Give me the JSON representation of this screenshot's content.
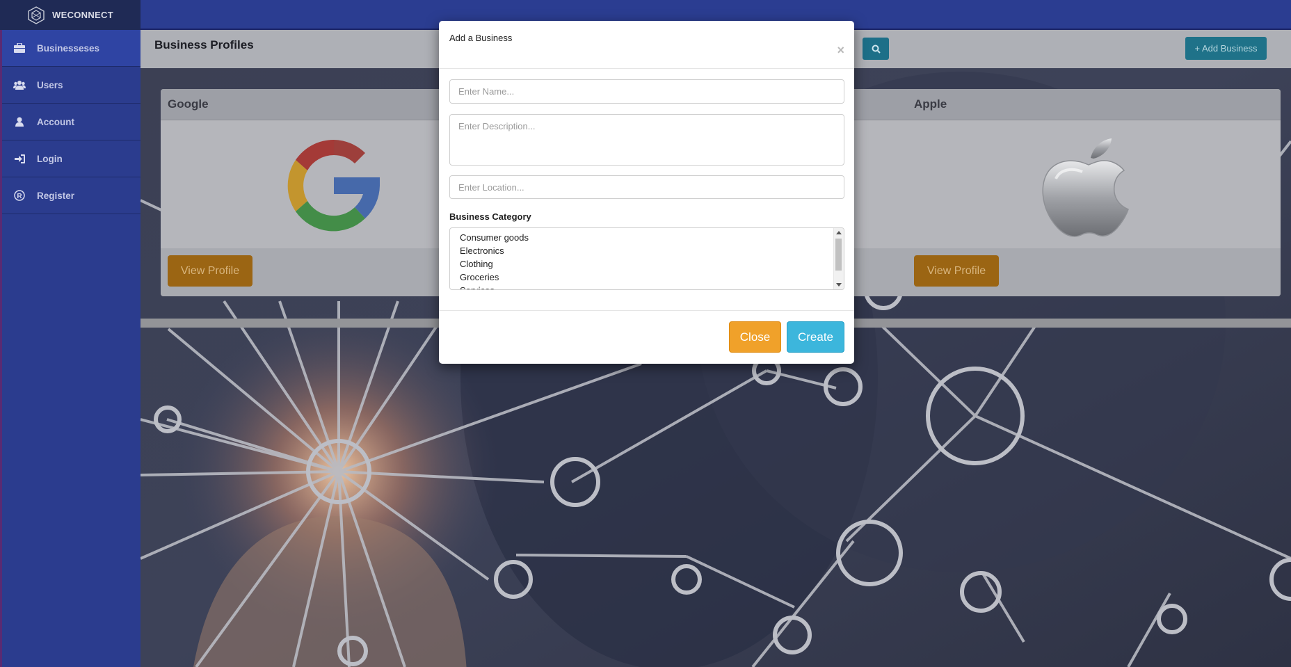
{
  "brand": {
    "name": "WECONNECT",
    "icon": "hexagon-logo-icon"
  },
  "sidebar": {
    "items": [
      {
        "label": "Businesseses",
        "icon": "briefcase-icon",
        "active": true
      },
      {
        "label": "Users",
        "icon": "users-icon",
        "active": false
      },
      {
        "label": "Account",
        "icon": "user-icon",
        "active": false
      },
      {
        "label": "Login",
        "icon": "sign-in-icon",
        "active": false
      },
      {
        "label": "Register",
        "icon": "registered-icon",
        "active": false
      }
    ]
  },
  "header": {
    "title": "Business Profiles",
    "search_icon": "search-icon",
    "add_label": "+ Add Business"
  },
  "cards": [
    {
      "name": "Google",
      "logo": "google-logo",
      "button": "View Profile"
    },
    {
      "name": "Apple",
      "logo": "apple-logo",
      "button": "View Profile"
    }
  ],
  "modal": {
    "title": "Add a Business",
    "close_symbol": "×",
    "name_placeholder": "Enter Name...",
    "description_placeholder": "Enter Description...",
    "location_placeholder": "Enter Location...",
    "category_label": "Business Category",
    "categories": [
      "Consumer goods",
      "Electronics",
      "Clothing",
      "Groceries",
      "Services"
    ],
    "close_label": "Close",
    "create_label": "Create"
  },
  "colors": {
    "sidebar": "#2b3c8e",
    "close_button": "#f0a12a",
    "create_button": "#3cb6dc",
    "view_button": "#9b6513"
  }
}
